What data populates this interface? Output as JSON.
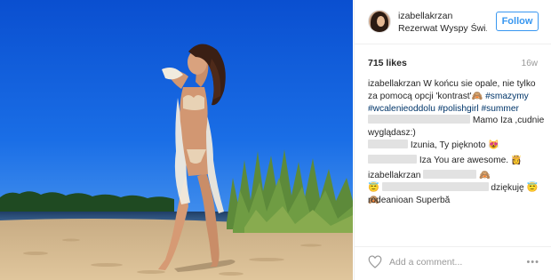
{
  "post": {
    "username": "izabellakrzan",
    "location": "Rezerwat Wyspy Świ...",
    "follow_label": "Follow",
    "likes": "715 likes",
    "age": "16w",
    "caption": {
      "user": "izabellakrzan",
      "text": " W końcu sie opale, nie tylko za pomocą opcji 'kontrast'🙈 ",
      "tags": [
        "#smazymy",
        "#wcalenieoddolu",
        "#polishgirl",
        "#summer"
      ]
    },
    "comments": [
      {
        "user": "",
        "text": " Mamo Iza ,cudnie wyglądasz:)"
      },
      {
        "user": "",
        "text": " Izunia, Ty pięknoto 😻"
      },
      {
        "user": "",
        "text": " Iza You are awesome. 👸"
      },
      {
        "user": "izabellakrzan",
        "text": " 🙈 ",
        "text2": "😇 ",
        "text3": " dziękuję 😇🙈"
      },
      {
        "user": "rodeanioan",
        "text": " Superbă"
      }
    ],
    "add_comment_placeholder": "Add a comment...",
    "more_label": "•••"
  },
  "colors": {
    "accent": "#3897f0",
    "hashtag": "#003569"
  }
}
